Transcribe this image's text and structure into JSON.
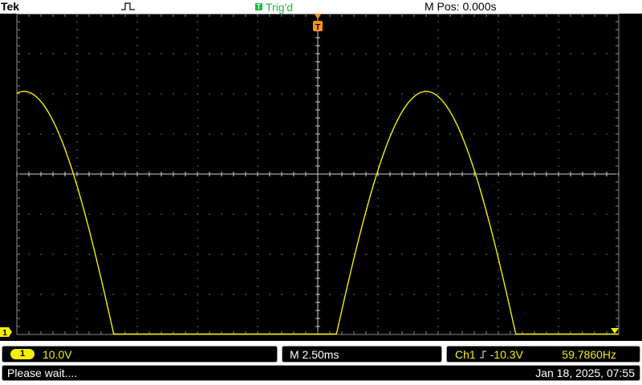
{
  "header": {
    "brand": "Tek",
    "trigger_status_icon": "T",
    "trigger_status": "Trig'd",
    "m_pos": "M Pos: 0.000s"
  },
  "bottom": {
    "channel_badge": "1",
    "channel_scale": "10.0V",
    "timebase": "M 2.50ms",
    "trigger_source": "Ch1",
    "trigger_slope_icon": "rising-edge-icon",
    "trigger_level": "-10.3V",
    "frequency": "59.7860Hz",
    "status": "Please wait....",
    "datetime": "Jan 18, 2025, 07:55"
  },
  "screen": {
    "ground_marker": "1",
    "trigger_marker": "T"
  },
  "colors": {
    "trace": "#f4ef00",
    "trig": "#17c03d",
    "trigger_position": "#f7941d"
  }
}
